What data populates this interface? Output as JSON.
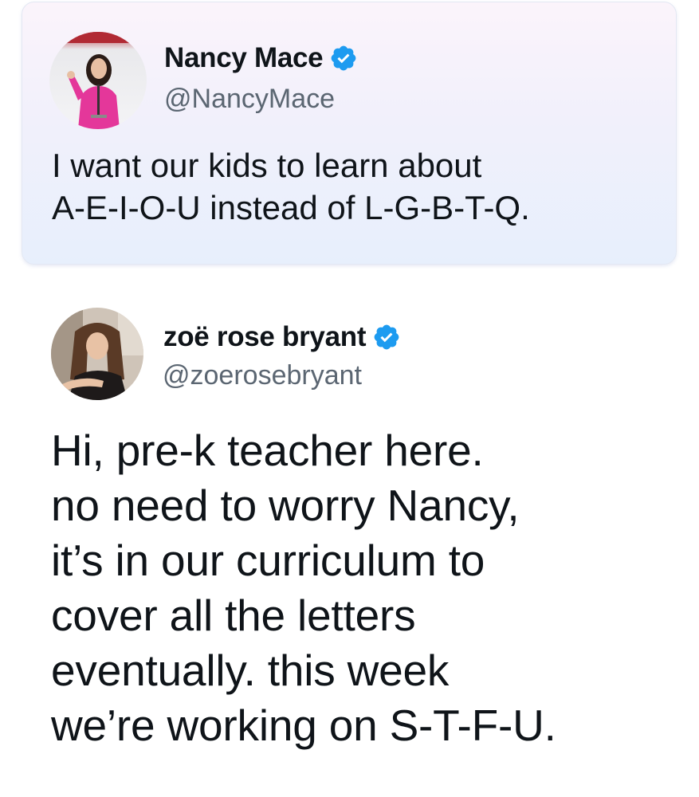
{
  "quoted_tweet": {
    "author_name": "Nancy Mace",
    "author_handle": "@NancyMace",
    "verified_icon": "verified-badge-icon",
    "text_lines": [
      "I want our kids to learn about",
      "A-E-I-O-U instead of L-G-B-T-Q."
    ]
  },
  "reply_tweet": {
    "author_name": "zoë rose bryant",
    "author_handle": "@zoerosebryant",
    "verified_icon": "verified-badge-icon",
    "text_lines": [
      "Hi, pre-k teacher here.",
      "no need to worry Nancy,",
      "it’s in our curriculum to",
      "cover all the letters",
      "eventually. this week",
      "we’re working on S-T-F-U."
    ]
  },
  "colors": {
    "verified_blue": "#1d9bf0",
    "text_primary": "#0f1419",
    "text_secondary": "#5b6672"
  }
}
